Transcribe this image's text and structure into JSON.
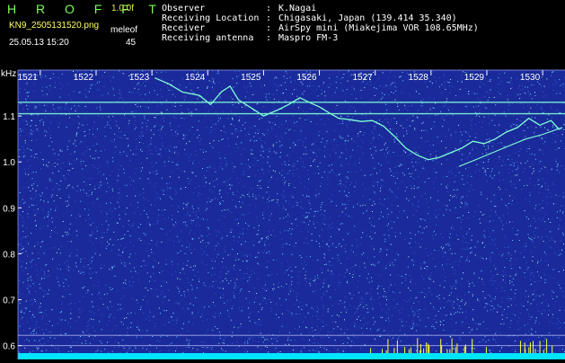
{
  "header": {
    "brand": "H R O F F T",
    "version": "1.0.0f",
    "filename": "KN9_2505131520.png",
    "param_label": "meleof",
    "timestamp": "25.05.13 15:20",
    "param_value": "45"
  },
  "meta": [
    {
      "key": "Observer",
      "value": "K.Nagai"
    },
    {
      "key": "Receiving Location",
      "value": "Chigasaki, Japan (139.414 35.340)"
    },
    {
      "key": "Receiver",
      "value": "AirSpy mini (Miakejima VOR 108.65MHz)"
    },
    {
      "key": "Receiving antenna",
      "value": "Maspro FM-3"
    }
  ],
  "chart_data": {
    "type": "heatmap",
    "ylabel": "kHz",
    "x_ticks": [
      "1521",
      "1522",
      "1523",
      "1524",
      "1525",
      "1526",
      "1527",
      "1528",
      "1529",
      "1530"
    ],
    "y_ticks": [
      "1.1",
      "1.0",
      "0.9",
      "0.8",
      "0.7",
      "0.6"
    ],
    "y_tick_values": [
      1.1,
      1.0,
      0.9,
      0.8,
      0.7,
      0.6
    ],
    "ylim": [
      0.57,
      1.2
    ],
    "x_tick_values": [
      1521,
      1522,
      1523,
      1524,
      1525,
      1526,
      1527,
      1528,
      1529,
      1530
    ],
    "xlim": [
      1520.6,
      1530.4
    ],
    "background_color": "#1a2a9a",
    "trace_color": "#7fffd4",
    "grid_line_color": "#c8c8ff",
    "noise_color": "#6ad3ff",
    "bottom_band_color": "#00e5ff",
    "spike_color": "#ffff33",
    "carrier_lines": [
      1.13,
      1.105
    ],
    "reference_lines": [
      0.6225,
      0.6
    ],
    "meteor_trace": [
      [
        1523.05,
        1.183
      ],
      [
        1523.3,
        1.17
      ],
      [
        1523.55,
        1.152
      ],
      [
        1523.85,
        1.145
      ],
      [
        1524.05,
        1.125
      ],
      [
        1524.25,
        1.153
      ],
      [
        1524.4,
        1.165
      ],
      [
        1524.55,
        1.135
      ],
      [
        1524.75,
        1.12
      ],
      [
        1525.0,
        1.1
      ],
      [
        1525.25,
        1.113
      ],
      [
        1525.45,
        1.125
      ],
      [
        1525.65,
        1.14
      ],
      [
        1525.85,
        1.128
      ],
      [
        1526.0,
        1.12
      ],
      [
        1526.2,
        1.105
      ],
      [
        1526.35,
        1.095
      ],
      [
        1526.55,
        1.092
      ],
      [
        1526.75,
        1.088
      ],
      [
        1526.95,
        1.09
      ],
      [
        1527.15,
        1.078
      ],
      [
        1527.35,
        1.055
      ],
      [
        1527.55,
        1.03
      ],
      [
        1527.75,
        1.015
      ],
      [
        1527.95,
        1.005
      ],
      [
        1528.15,
        1.01
      ],
      [
        1528.35,
        1.02
      ],
      [
        1528.55,
        1.03
      ],
      [
        1528.75,
        1.045
      ],
      [
        1528.95,
        1.04
      ],
      [
        1529.15,
        1.05
      ],
      [
        1529.35,
        1.065
      ],
      [
        1529.55,
        1.075
      ],
      [
        1529.75,
        1.095
      ],
      [
        1529.95,
        1.08
      ],
      [
        1530.15,
        1.09
      ],
      [
        1530.3,
        1.07
      ]
    ],
    "meteor_trace_2": [
      [
        1528.5,
        0.99
      ],
      [
        1528.8,
        1.005
      ],
      [
        1529.1,
        1.02
      ],
      [
        1529.4,
        1.035
      ],
      [
        1529.7,
        1.05
      ],
      [
        1530.0,
        1.06
      ],
      [
        1530.35,
        1.075
      ]
    ]
  }
}
